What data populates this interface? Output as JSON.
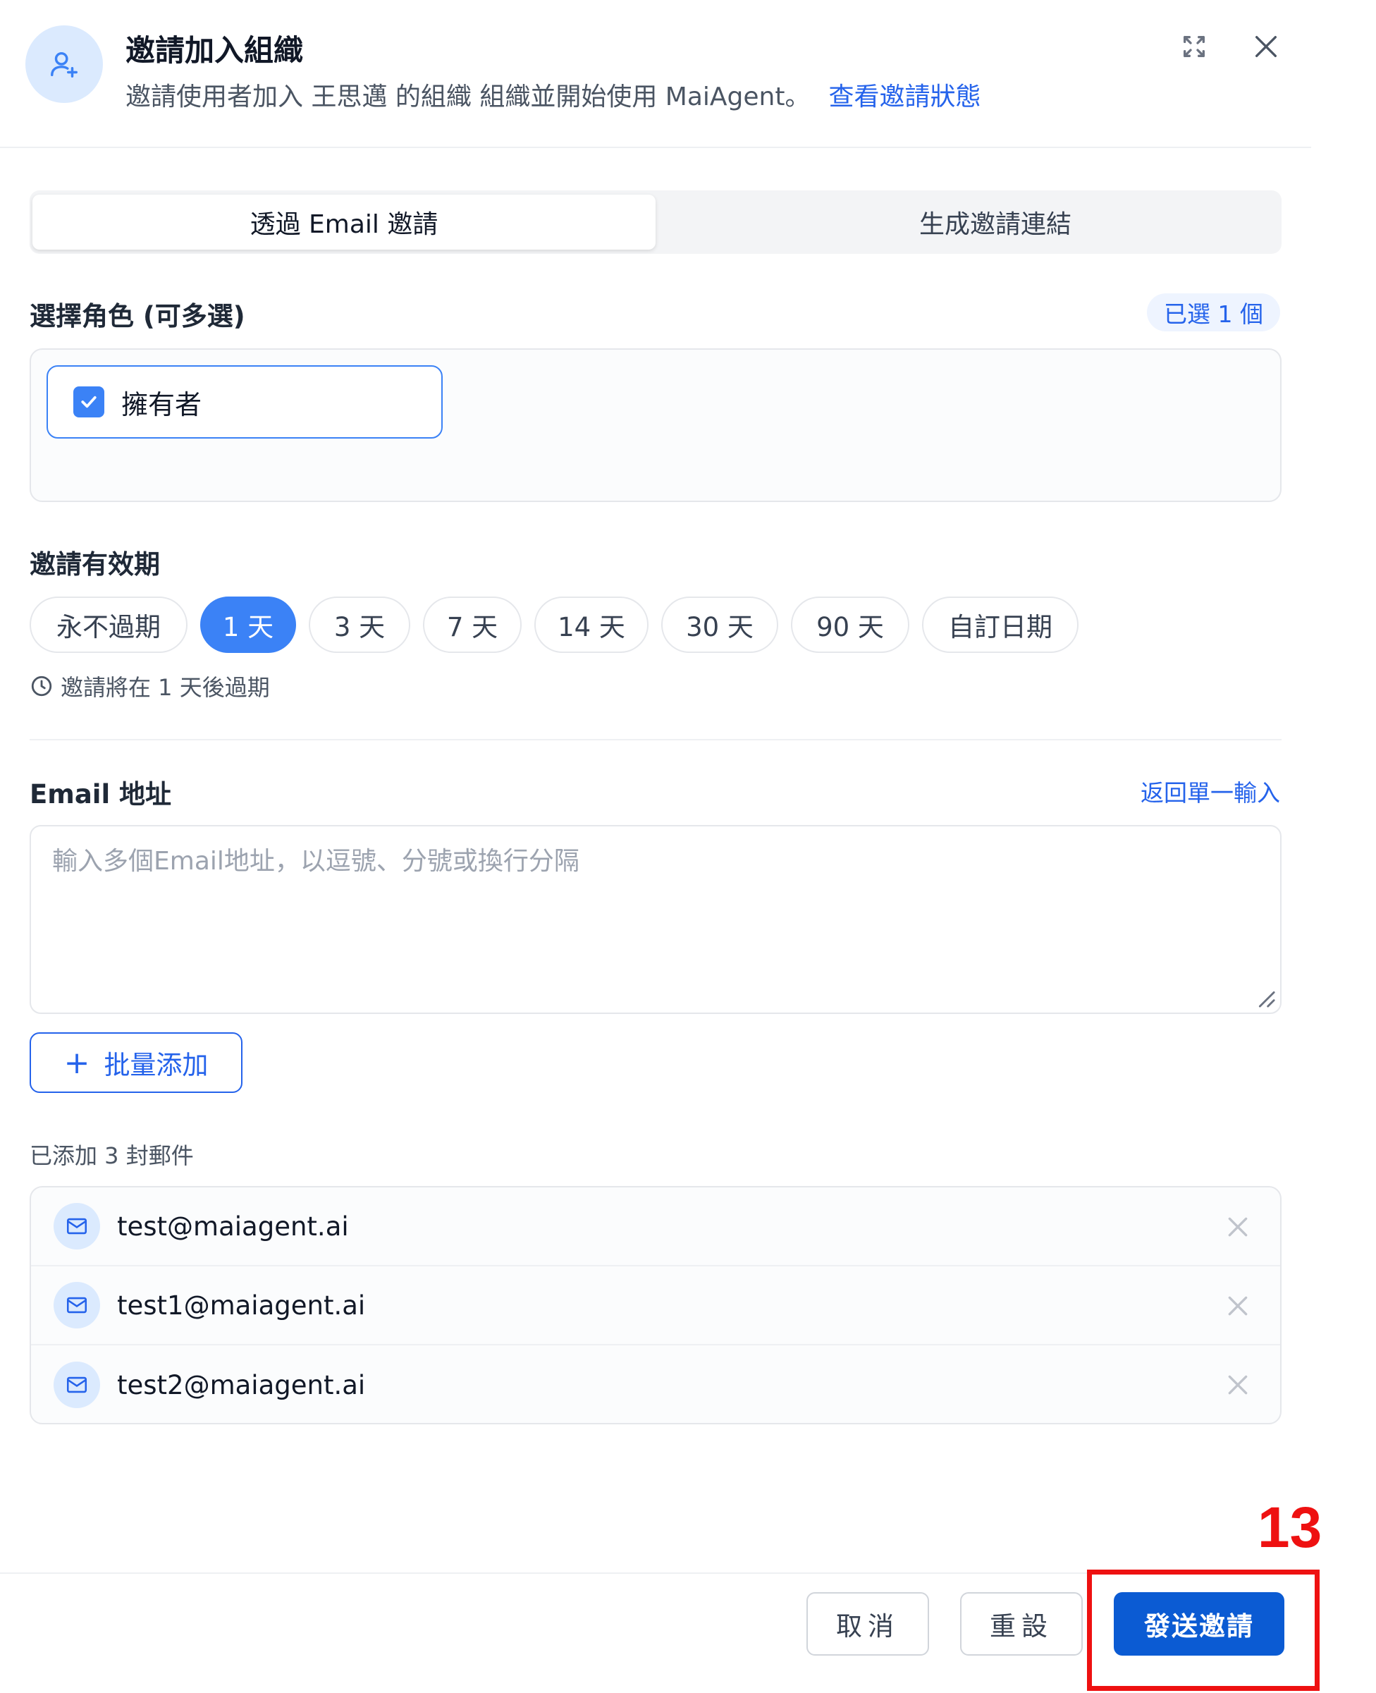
{
  "header": {
    "title": "邀請加入組織",
    "subtitle": "邀請使用者加入 王思邁 的組織 組織並開始使用 MaiAgent。",
    "status_link": "查看邀請狀態"
  },
  "tabs": [
    {
      "label": "透過 Email 邀請",
      "active": true
    },
    {
      "label": "生成邀請連結",
      "active": false
    }
  ],
  "roles": {
    "label": "選擇角色 (可多選)",
    "selected_badge": "已選 1 個",
    "items": [
      {
        "label": "擁有者",
        "checked": true
      }
    ]
  },
  "expiry": {
    "label": "邀請有效期",
    "options": [
      "永不過期",
      "1 天",
      "3 天",
      "7 天",
      "14 天",
      "30 天",
      "90 天",
      "自訂日期"
    ],
    "selected": "1 天",
    "note": "邀請將在 1 天後過期"
  },
  "email": {
    "label": "Email 地址",
    "back_link": "返回單一輸入",
    "placeholder": "輸入多個Email地址，以逗號、分號或換行分隔",
    "bulk_add": "批量添加",
    "added_count": "已添加 3 封郵件",
    "list": [
      "test@maiagent.ai",
      "test1@maiagent.ai",
      "test2@maiagent.ai"
    ]
  },
  "footer": {
    "cancel": "取消",
    "reset": "重設",
    "send": "發送邀請"
  },
  "annotation": {
    "step": "13",
    "color": "#ee1111"
  },
  "colors": {
    "accent": "#3b82f6",
    "primary_button": "#0b5bd3",
    "link": "#2563eb"
  }
}
